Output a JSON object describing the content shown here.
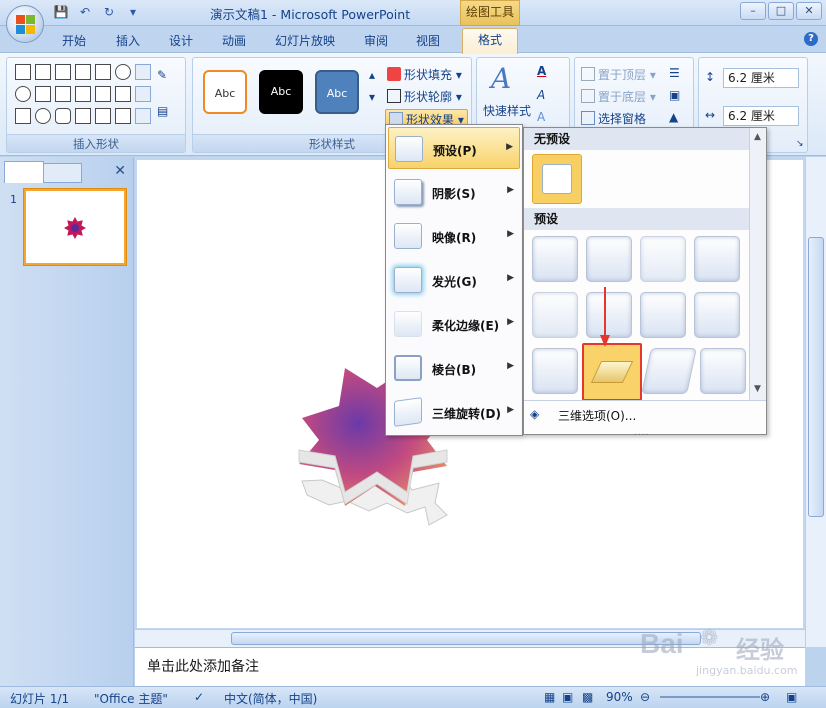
{
  "titlebar": {
    "title": "演示文稿1 - Microsoft PowerPoint",
    "contextual_tools": "绘图工具",
    "window_controls": [
      "–",
      "□",
      "✕"
    ]
  },
  "tabs": {
    "items": [
      "开始",
      "插入",
      "设计",
      "动画",
      "幻灯片放映",
      "审阅",
      "视图"
    ],
    "active": "格式"
  },
  "ribbon": {
    "groups": {
      "insert_shapes": "插入形状",
      "shape_styles": "形状样式"
    },
    "style_samples": [
      "Abc",
      "Abc",
      "Abc"
    ],
    "shape_fill": "形状填充",
    "shape_outline": "形状轮廓",
    "shape_effects": "形状效果",
    "quick_styles": "快速样式",
    "bring_front": "置于顶层",
    "send_back": "置于底层",
    "selection_pane": "选择窗格",
    "height_value": "6.2 厘米",
    "width_value": "6.2 厘米"
  },
  "left_panel": {
    "slide_number": "1"
  },
  "effects_menu": {
    "items": [
      {
        "label": "预设(P)"
      },
      {
        "label": "阴影(S)"
      },
      {
        "label": "映像(R)"
      },
      {
        "label": "发光(G)"
      },
      {
        "label": "柔化边缘(E)"
      },
      {
        "label": "棱台(B)"
      },
      {
        "label": "三维旋转(D)"
      }
    ]
  },
  "preset_panel": {
    "no_preset_header": "无预设",
    "preset_header": "预设",
    "three_d_options": "三维选项(O)...",
    "grip": "....",
    "tile_count": 12,
    "selected_index": 9
  },
  "notes": {
    "placeholder": "单击此处添加备注"
  },
  "status": {
    "slide_info": "幻灯片 1/1",
    "theme": "\"Office 主题\"",
    "language": "中文(简体，中国)",
    "zoom": "90%"
  },
  "watermark": {
    "brand": "Bai",
    "brand2": "经验",
    "url": "jingyan.baidu.com"
  },
  "colors": {
    "accent_orange": "#f8d36a",
    "selection_red": "#e4382c",
    "ribbon_blue": "#15428b"
  }
}
